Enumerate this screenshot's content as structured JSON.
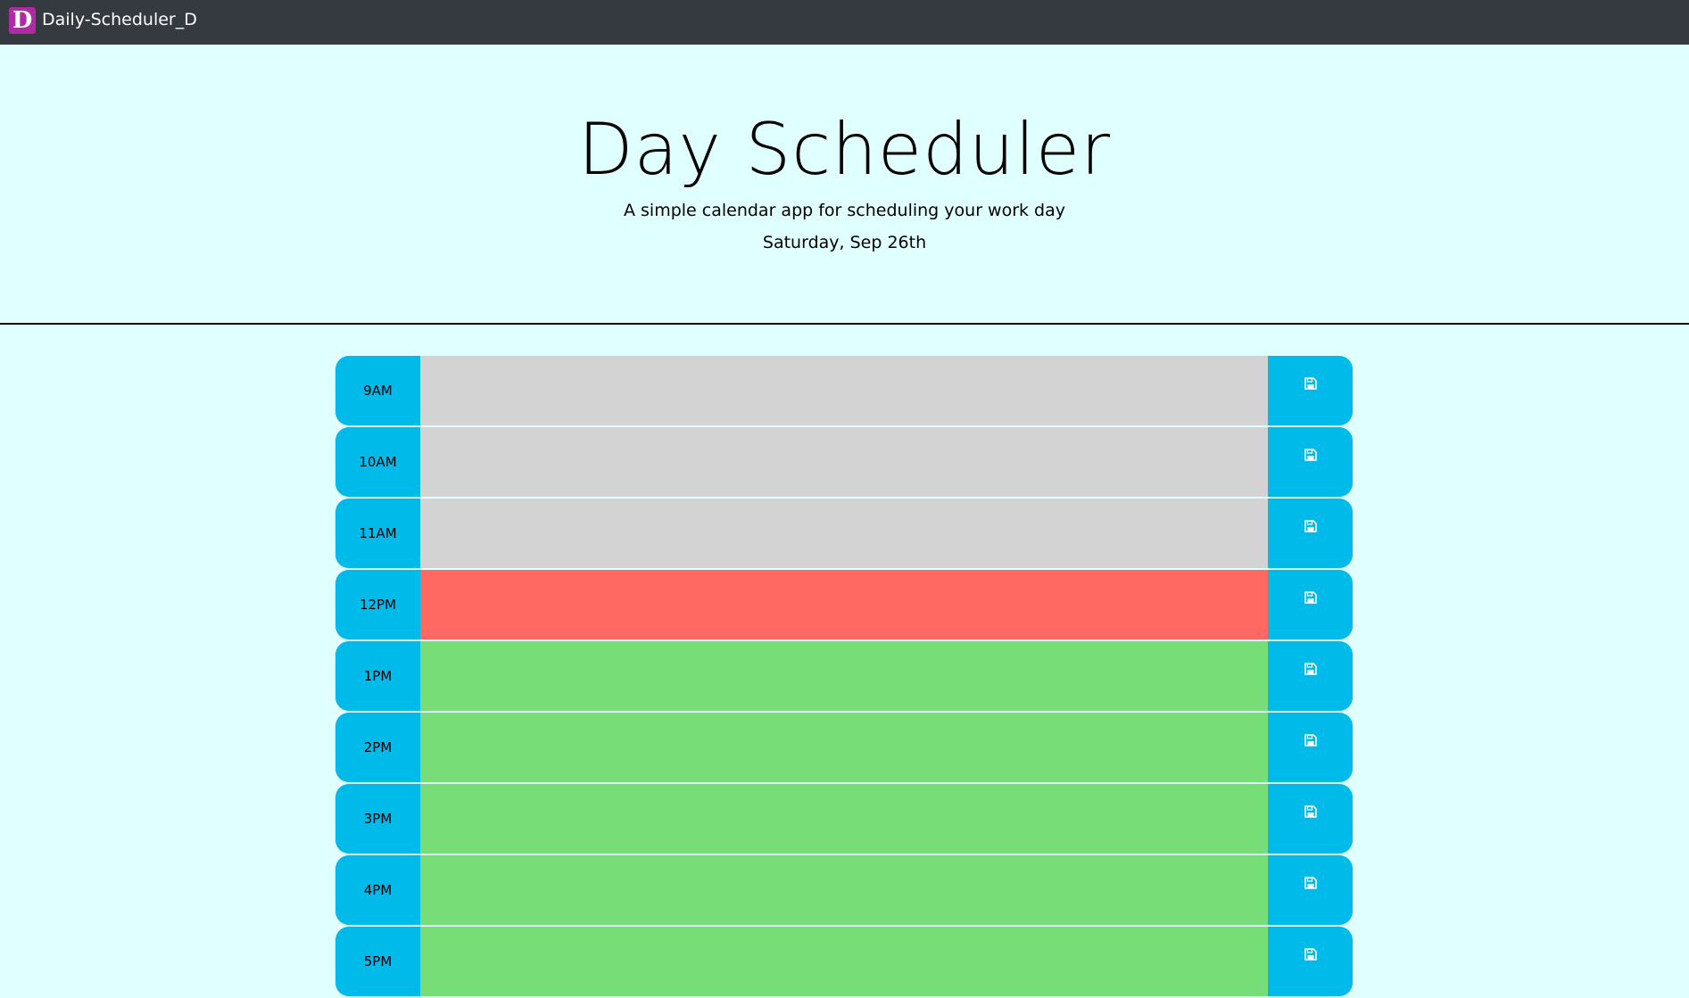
{
  "navbar": {
    "logo_letter": "D",
    "brand": "Daily-Scheduler_D"
  },
  "header": {
    "title": "Day Scheduler",
    "subtitle": "A simple calendar app for scheduling your work day",
    "current_day": "Saturday, Sep 26th"
  },
  "time_blocks": [
    {
      "hour": "9AM",
      "state": "past",
      "text": "",
      "save_icon": "save-icon"
    },
    {
      "hour": "10AM",
      "state": "past",
      "text": "",
      "save_icon": "save-icon"
    },
    {
      "hour": "11AM",
      "state": "past",
      "text": "",
      "save_icon": "save-icon"
    },
    {
      "hour": "12PM",
      "state": "present",
      "text": "",
      "save_icon": "save-icon"
    },
    {
      "hour": "1PM",
      "state": "future",
      "text": "",
      "save_icon": "save-icon"
    },
    {
      "hour": "2PM",
      "state": "future",
      "text": "",
      "save_icon": "save-icon"
    },
    {
      "hour": "3PM",
      "state": "future",
      "text": "",
      "save_icon": "save-icon"
    },
    {
      "hour": "4PM",
      "state": "future",
      "text": "",
      "save_icon": "save-icon"
    },
    {
      "hour": "5PM",
      "state": "future",
      "text": "",
      "save_icon": "save-icon"
    }
  ],
  "colors": {
    "navbar": "#343a40",
    "page_background": "#e0ffff",
    "accent": "#00bbea",
    "past": "#d3d3d3",
    "present": "#ff6961",
    "future": "#77dd77",
    "logo": "#b02aa4"
  }
}
